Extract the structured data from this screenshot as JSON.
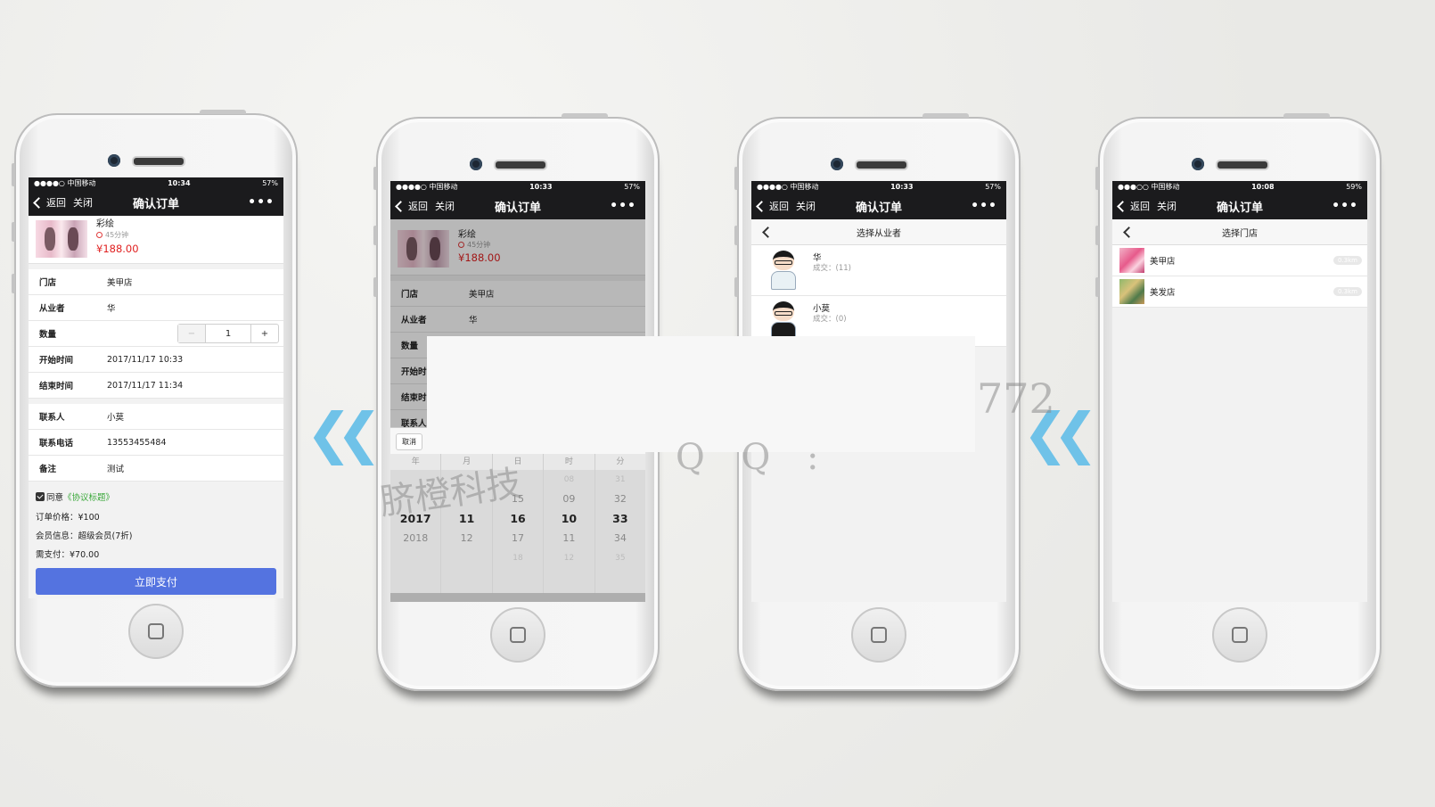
{
  "status": {
    "carrier": "●●●●○ 中国移动",
    "carrier4": "●●●○○ 中国移动",
    "battery1": "57%",
    "battery4": "59%",
    "time1": "10:34",
    "time2": "10:33",
    "time3": "10:33",
    "time4": "10:08"
  },
  "nav": {
    "back": "返回",
    "close": "关闭",
    "title": "确认订单",
    "more": "•••"
  },
  "product": {
    "name": "彩绘",
    "duration": "45分钟",
    "price": "¥188.00"
  },
  "order_fields": [
    {
      "label": "门店",
      "value": "美甲店"
    },
    {
      "label": "从业者",
      "value": "华"
    },
    {
      "label": "数量",
      "value": ""
    },
    {
      "label": "开始时间",
      "value": "2017/11/17 10:33"
    },
    {
      "label": "结束时间",
      "value": "2017/11/17 11:34"
    }
  ],
  "quantity": {
    "minus": "−",
    "value": "1",
    "plus": "+"
  },
  "contact_fields": [
    {
      "label": "联系人",
      "value": "小莫"
    },
    {
      "label": "联系电话",
      "value": "13553455484"
    },
    {
      "label": "备注",
      "value": "测试"
    }
  ],
  "agree": {
    "text": "同意",
    "link": "《协议标题》"
  },
  "summary": {
    "order_price": "订单价格：¥100",
    "member_info": "会员信息：超级会员(7折)",
    "need_pay": "需支付：¥70.00"
  },
  "pay_button": "立即支付",
  "picker": {
    "cancel": "取消",
    "columns": [
      {
        "head": "年",
        "items": [
          "",
          "",
          "2017",
          "2018",
          ""
        ]
      },
      {
        "head": "月",
        "items": [
          "",
          "",
          "11",
          "12",
          ""
        ]
      },
      {
        "head": "日",
        "items": [
          "",
          "15",
          "16",
          "17",
          "18"
        ]
      },
      {
        "head": "时",
        "items": [
          "08",
          "09",
          "10",
          "11",
          "12"
        ]
      },
      {
        "head": "分",
        "items": [
          "31",
          "32",
          "33",
          "34",
          "35"
        ]
      }
    ]
  },
  "picker_partial_labels": {
    "field1": "门店",
    "field2": "从业者",
    "field3": "数量",
    "field4": "开始时",
    "field5": "结束时",
    "field6": "联系人"
  },
  "practitioner_page": {
    "title": "选择从业者",
    "items": [
      {
        "name": "华",
        "deals": "成交：(11)"
      },
      {
        "name": "小莫",
        "deals": "成交：(0)"
      }
    ]
  },
  "store_page": {
    "title": "选择门店",
    "items": [
      {
        "name": "美甲店",
        "distance": "0.3km"
      },
      {
        "name": "美发店",
        "distance": "0.3km"
      }
    ]
  },
  "watermark": {
    "company": "脐橙科技",
    "qq": "Q Q :",
    "number": "772"
  },
  "colors": {
    "pay": "#5473e0",
    "price": "#e02020",
    "link": "#3aa83a",
    "arrow": "#6fc2e8",
    "navbar": "#1b1b1d"
  }
}
